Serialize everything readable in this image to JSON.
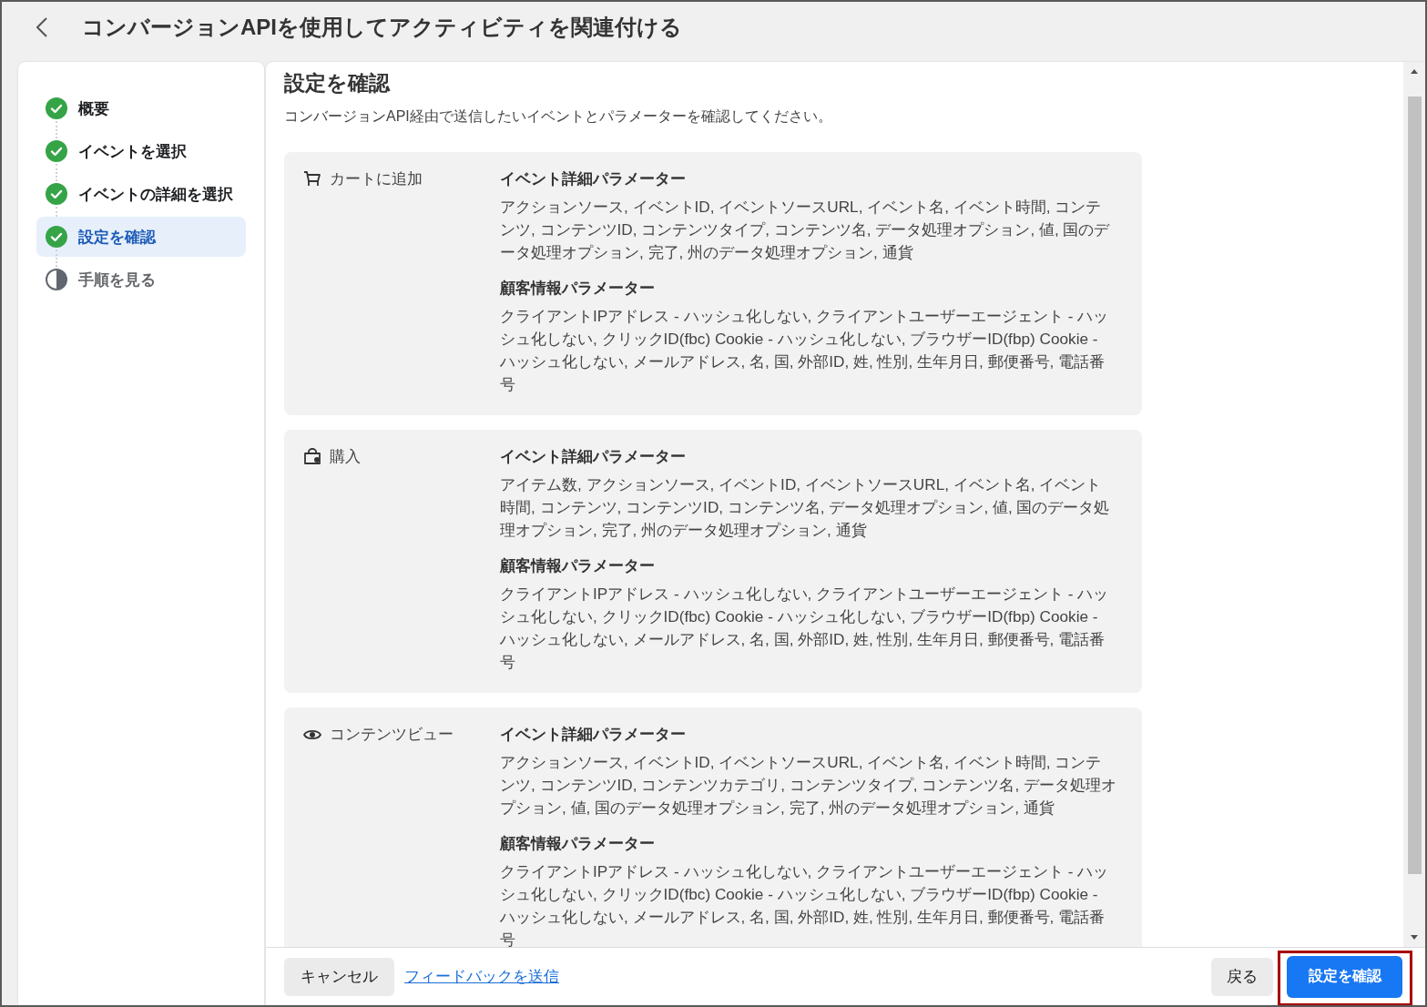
{
  "header": {
    "title": "コンバージョンAPIを使用してアクティビティを関連付ける"
  },
  "steps": [
    {
      "label": "概要",
      "completed": true,
      "selected": false
    },
    {
      "label": "イベントを選択",
      "completed": true,
      "selected": false
    },
    {
      "label": "イベントの詳細を選択",
      "completed": true,
      "selected": false
    },
    {
      "label": "設定を確認",
      "completed": true,
      "selected": true
    },
    {
      "label": "手順を見る",
      "completed": false,
      "selected": false
    }
  ],
  "main": {
    "heading": "設定を確認",
    "description": "コンバージョンAPI経由で送信したいイベントとパラメーターを確認してください。",
    "events": [
      {
        "kind": "add_to_cart",
        "name": "カートに追加",
        "sections": [
          {
            "heading": "イベント詳細パラメーター",
            "text": "アクションソース, イベントID, イベントソースURL, イベント名, イベント時間, コンテンツ, コンテンツID, コンテンツタイプ, コンテンツ名, データ処理オプション, 値, 国のデータ処理オプション, 完了, 州のデータ処理オプション, 通貨"
          },
          {
            "heading": "顧客情報パラメーター",
            "text": "クライアントIPアドレス - ハッシュ化しない, クライアントユーザーエージェント - ハッシュ化しない, クリックID(fbc) Cookie - ハッシュ化しない, ブラウザーID(fbp) Cookie - ハッシュ化しない, メールアドレス, 名, 国, 外部ID, 姓, 性別, 生年月日, 郵便番号, 電話番号"
          }
        ]
      },
      {
        "kind": "purchase",
        "name": "購入",
        "sections": [
          {
            "heading": "イベント詳細パラメーター",
            "text": "アイテム数, アクションソース, イベントID, イベントソースURL, イベント名, イベント時間, コンテンツ, コンテンツID, コンテンツ名, データ処理オプション, 値, 国のデータ処理オプション, 完了, 州のデータ処理オプション, 通貨"
          },
          {
            "heading": "顧客情報パラメーター",
            "text": "クライアントIPアドレス - ハッシュ化しない, クライアントユーザーエージェント - ハッシュ化しない, クリックID(fbc) Cookie - ハッシュ化しない, ブラウザーID(fbp) Cookie - ハッシュ化しない, メールアドレス, 名, 国, 外部ID, 姓, 性別, 生年月日, 郵便番号, 電話番号"
          }
        ]
      },
      {
        "kind": "content_view",
        "name": "コンテンツビュー",
        "sections": [
          {
            "heading": "イベント詳細パラメーター",
            "text": "アクションソース, イベントID, イベントソースURL, イベント名, イベント時間, コンテンツ, コンテンツID, コンテンツカテゴリ, コンテンツタイプ, コンテンツ名, データ処理オプション, 値, 国のデータ処理オプション, 完了, 州のデータ処理オプション, 通貨"
          },
          {
            "heading": "顧客情報パラメーター",
            "text": "クライアントIPアドレス - ハッシュ化しない, クライアントユーザーエージェント - ハッシュ化しない, クリックID(fbc) Cookie - ハッシュ化しない, ブラウザーID(fbp) Cookie - ハッシュ化しない, メールアドレス, 名, 国, 外部ID, 姓, 性別, 生年月日, 郵便番号, 電話番号"
          }
        ]
      }
    ]
  },
  "footer": {
    "cancel_button": "キャンセル",
    "feedback_link": "フィードバックを送信",
    "back_button": "戻る",
    "confirm_button": {
      "label": "設定を確認",
      "highlighted": true
    }
  }
}
